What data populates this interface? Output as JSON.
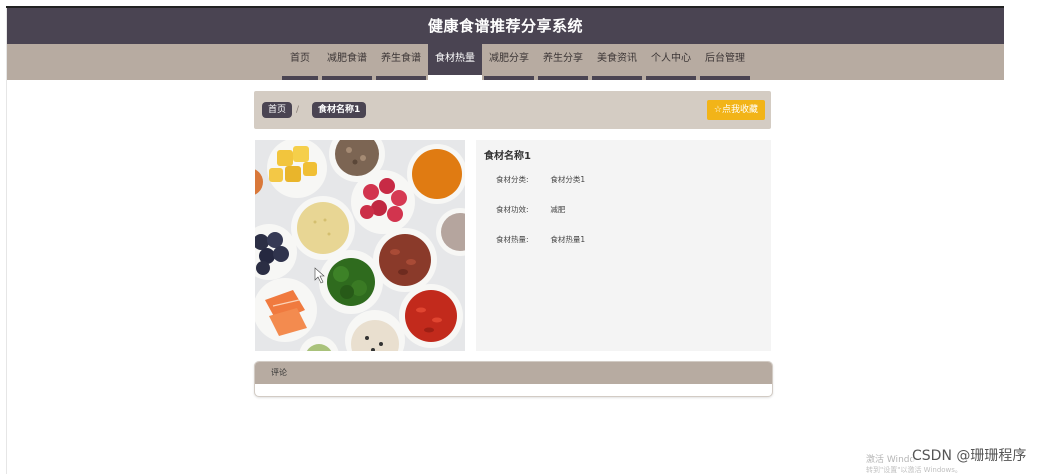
{
  "site_title": "健康食谱推荐分享系统",
  "nav": [
    {
      "label": "首页",
      "active": false
    },
    {
      "label": "减肥食谱",
      "active": false
    },
    {
      "label": "养生食谱",
      "active": false
    },
    {
      "label": "食材热量",
      "active": true
    },
    {
      "label": "减肥分享",
      "active": false
    },
    {
      "label": "养生分享",
      "active": false
    },
    {
      "label": "美食资讯",
      "active": false
    },
    {
      "label": "个人中心",
      "active": false
    },
    {
      "label": "后台管理",
      "active": false
    }
  ],
  "breadcrumb": {
    "home": "首页",
    "separator": "/",
    "current": "食材名称1"
  },
  "favorite_button": {
    "icon": "star-outline-icon",
    "label": "☆点我收藏"
  },
  "detail": {
    "title": "食材名称1",
    "rows": [
      {
        "label": "食材分类:",
        "value": "食材分类1"
      },
      {
        "label": "食材功效:",
        "value": "减肥"
      },
      {
        "label": "食材热量:",
        "value": "食材热量1"
      }
    ]
  },
  "comments": {
    "header": "评论"
  },
  "watermarks": {
    "windows_line1": "激活 Windo",
    "windows_line2": "转到\"设置\"以激活 Windows。",
    "csdn": "CSDN @珊珊程序"
  },
  "colors": {
    "header_bg": "#4a4452",
    "nav_bg": "#b7aba1",
    "breadcrumb_bg": "#d4ccc3",
    "favorite_bg": "#f2b418",
    "info_bg": "#f4f4f4"
  }
}
